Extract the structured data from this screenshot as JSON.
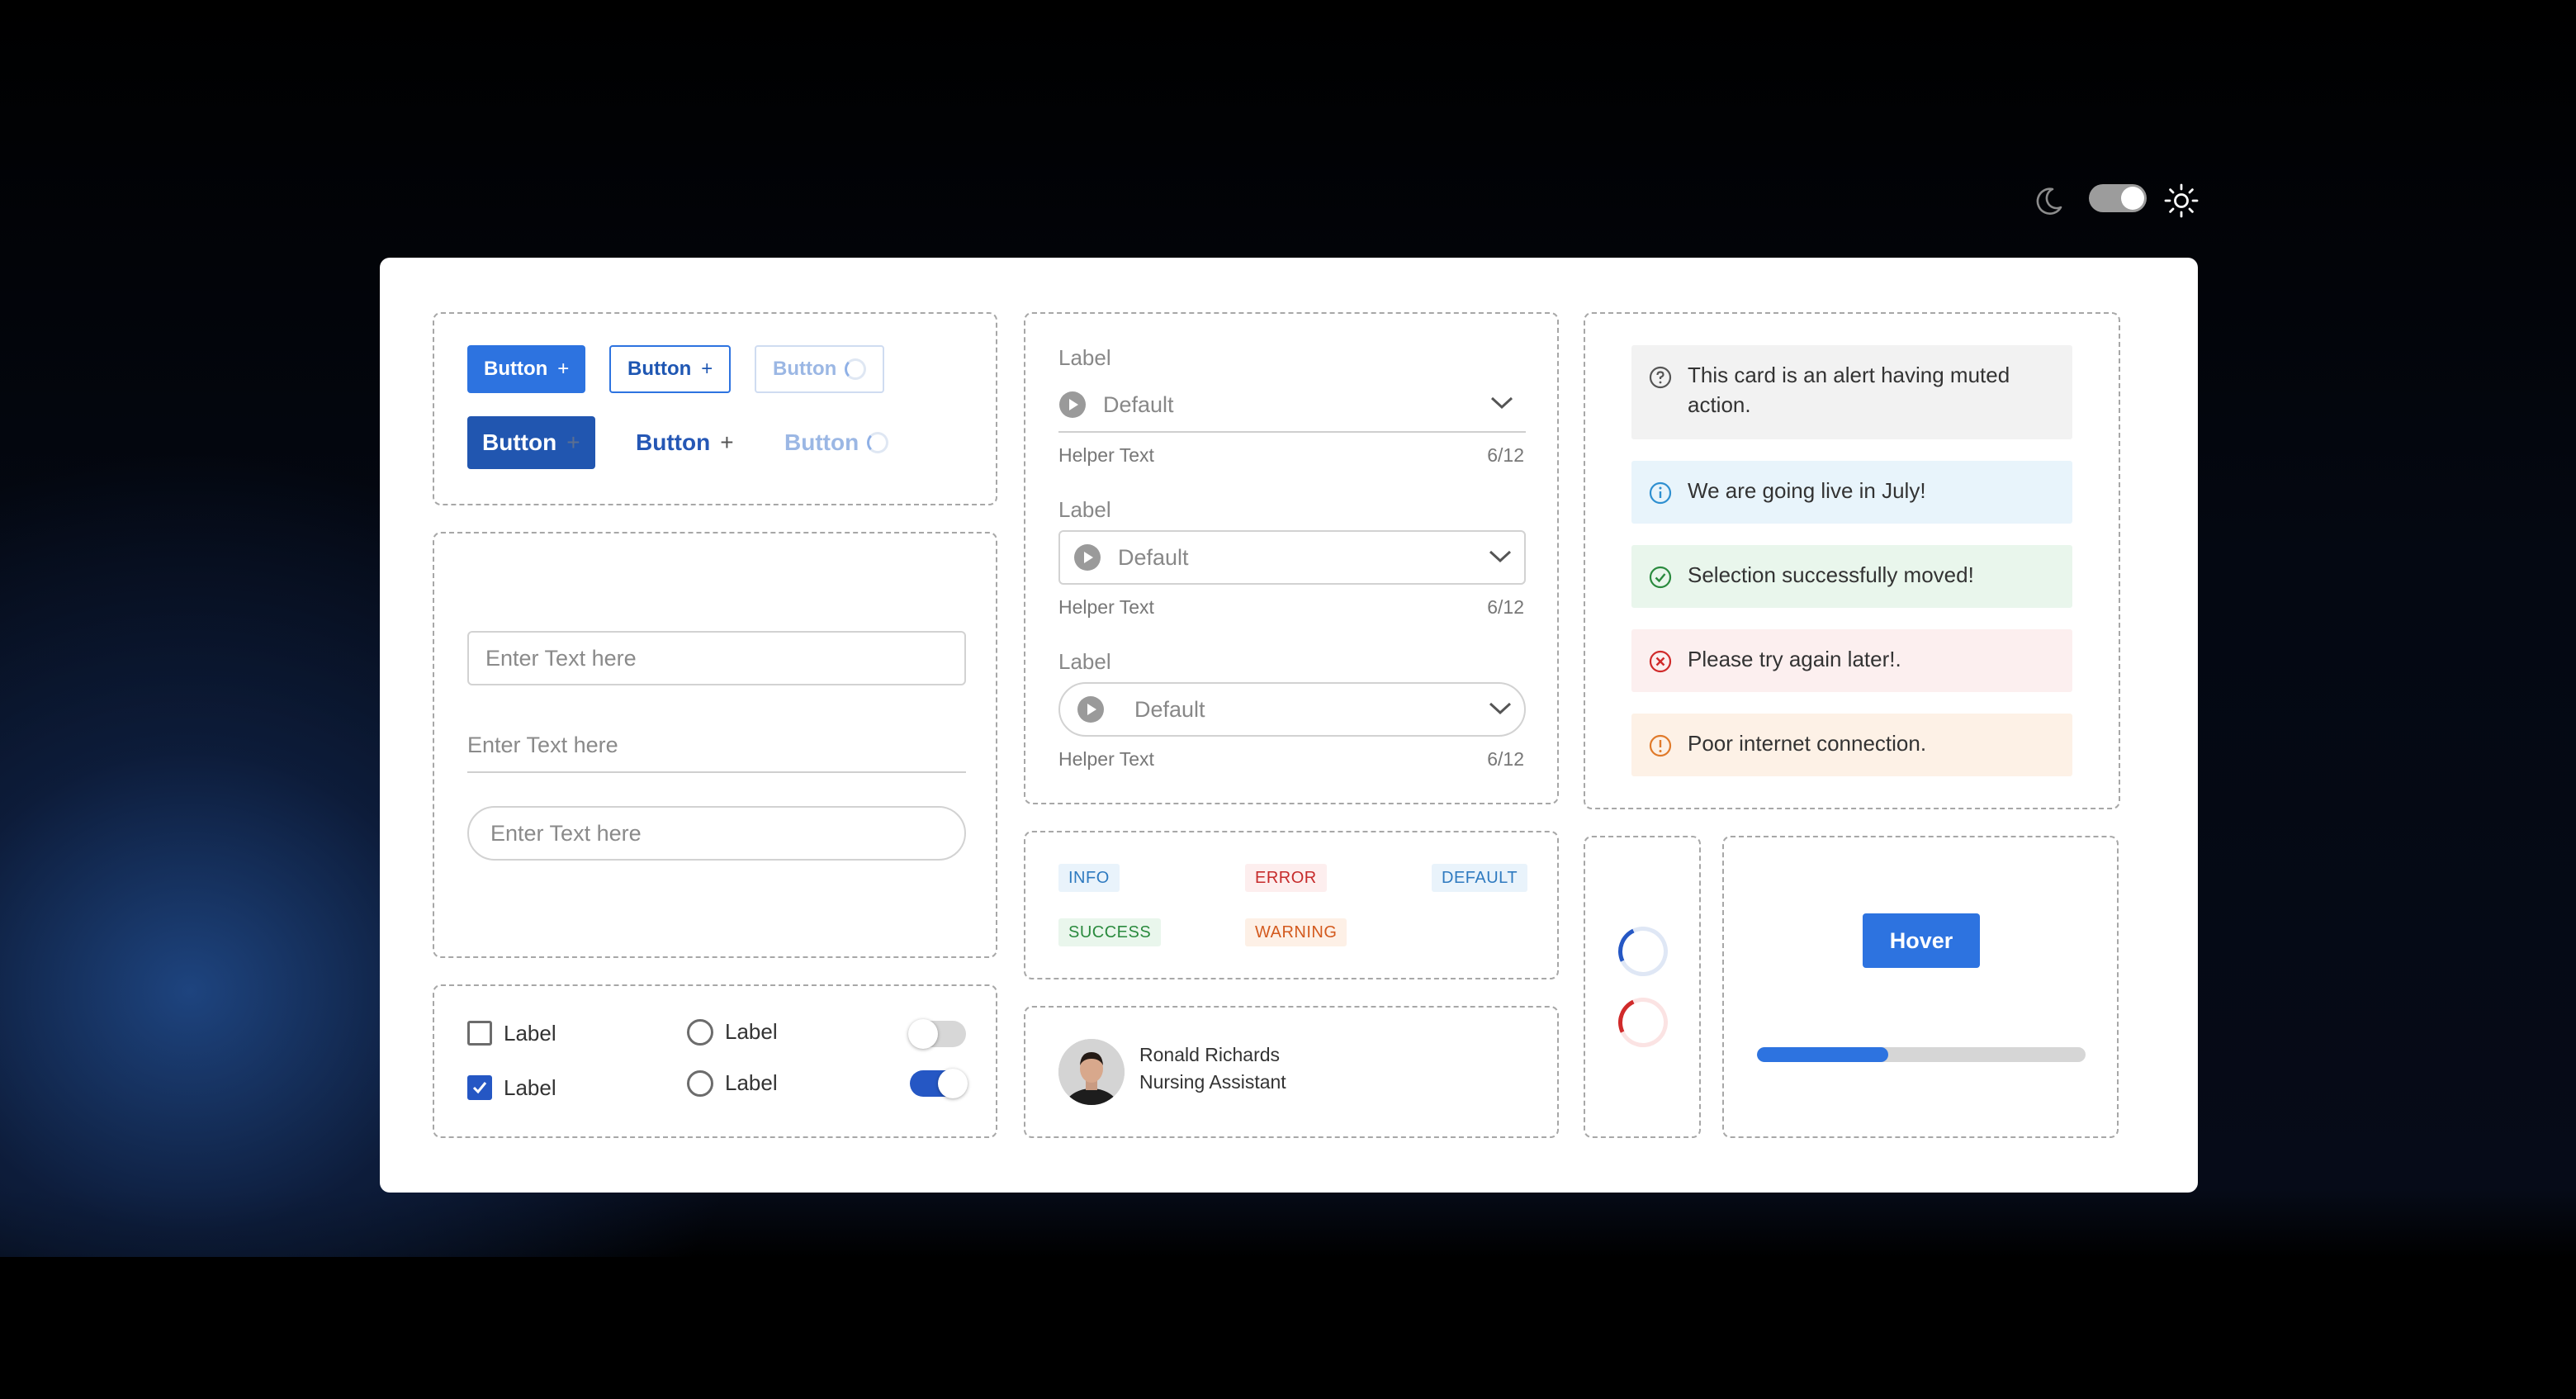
{
  "theme_toggle": {
    "moon_icon": "moon-icon",
    "sun_icon": "sun-icon",
    "state": "on"
  },
  "buttons": {
    "row1": [
      {
        "label": "Button",
        "variant": "primary",
        "icon": "plus-icon"
      },
      {
        "label": "Button",
        "variant": "outline",
        "icon": "plus-icon"
      },
      {
        "label": "Button",
        "variant": "outline-disabled",
        "icon": "spinner-icon"
      }
    ],
    "row2": [
      {
        "label": "Button",
        "variant": "primary-dark",
        "icon": "plus-icon"
      },
      {
        "label": "Button",
        "variant": "text",
        "icon": "plus-icon"
      },
      {
        "label": "Button",
        "variant": "text-disabled",
        "icon": "spinner-icon"
      }
    ]
  },
  "text_inputs": {
    "boxed_placeholder": "Enter Text here",
    "underlined_placeholder": "Enter Text here",
    "pill_placeholder": "Enter Text here"
  },
  "selection_controls": {
    "checkbox_unchecked_label": "Label",
    "checkbox_checked_label": "Label",
    "radio_1_label": "Label",
    "radio_2_label": "Label",
    "toggle_1_state": "off",
    "toggle_2_state": "on"
  },
  "selects": [
    {
      "label": "Label",
      "value": "Default",
      "helper": "Helper Text",
      "counter": "6/12",
      "style": "underline"
    },
    {
      "label": "Label",
      "value": "Default",
      "helper": "Helper Text",
      "counter": "6/12",
      "style": "box"
    },
    {
      "label": "Label",
      "value": "Default",
      "helper": "Helper Text",
      "counter": "6/12",
      "style": "pill"
    }
  ],
  "tags": {
    "info": "INFO",
    "error": "ERROR",
    "default": "DEFAULT",
    "success": "SUCCESS",
    "warning": "WARNING"
  },
  "profile": {
    "name": "Ronald Richards",
    "role": "Nursing Assistant"
  },
  "alerts": [
    {
      "type": "muted",
      "text": "This card is an alert having muted action.",
      "icon": "question-circle-icon"
    },
    {
      "type": "info",
      "text": "We are going live in July!",
      "icon": "info-circle-icon"
    },
    {
      "type": "success",
      "text": "Selection successfully moved!",
      "icon": "check-circle-icon"
    },
    {
      "type": "error",
      "text": "Please try again later!.",
      "icon": "x-circle-icon"
    },
    {
      "type": "warning",
      "text": "Poor internet connection.",
      "icon": "exclamation-circle-icon"
    }
  ],
  "hover_panel": {
    "button_label": "Hover",
    "progress": 0.4
  },
  "colors": {
    "primary": "#2d73e0",
    "primary_dark": "#2156b0",
    "checked": "#2557c4",
    "error": "#d02a2a"
  }
}
